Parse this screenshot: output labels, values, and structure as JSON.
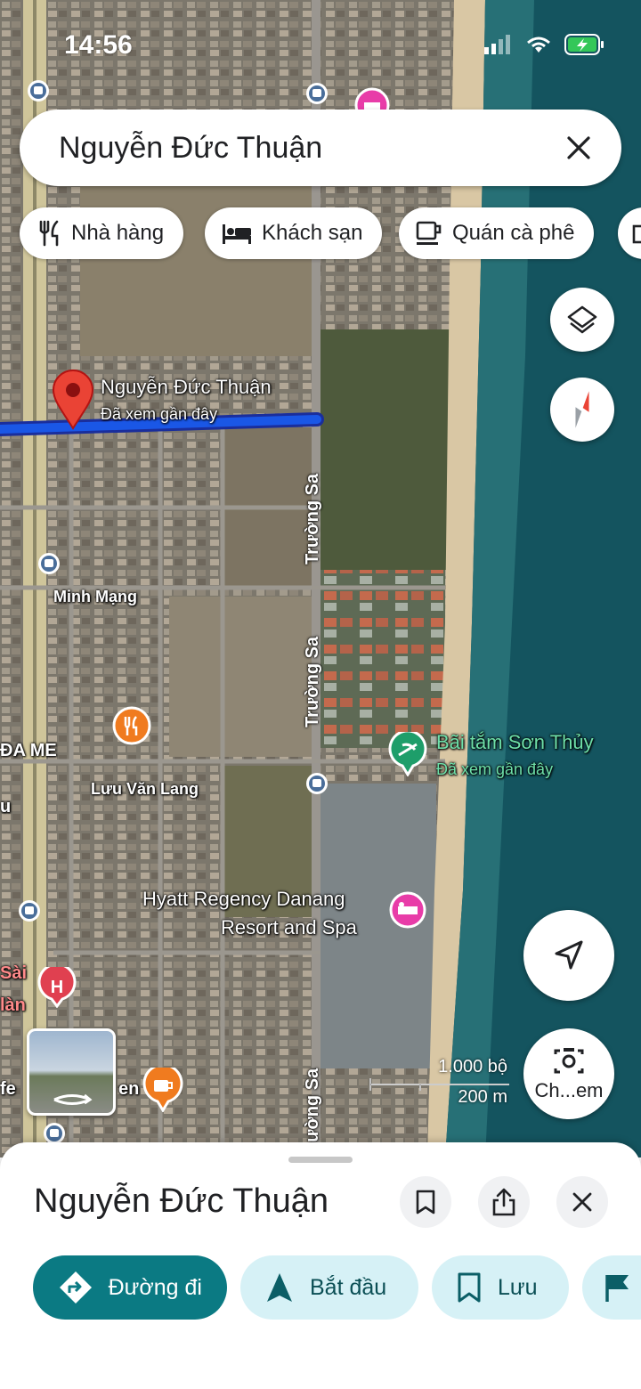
{
  "status_bar": {
    "time": "14:56"
  },
  "search": {
    "query": "Nguyễn Đức Thuận"
  },
  "chips": [
    {
      "label": "Nhà hàng",
      "icon": "fork-knife-icon"
    },
    {
      "label": "Khách sạn",
      "icon": "bed-icon"
    },
    {
      "label": "Quán cà phê",
      "icon": "coffee-cup-icon"
    }
  ],
  "map": {
    "pin": {
      "title": "Nguyễn Đức Thuận",
      "subtitle": "Đã xem gần đây"
    },
    "beach": {
      "title": "Bãi tắm Sơn Thủy",
      "subtitle": "Đã xem gần đây"
    },
    "hotel": {
      "line1": "Hyatt Regency Danang",
      "line2": "Resort and Spa"
    },
    "streets": {
      "minh_mang": "Minh Mạng",
      "luu_van_lang": "Lưu Văn Lang",
      "truong_sa": "Trường Sa",
      "da_me": "ĐA ME",
      "sai": "Sài",
      "han": "làn",
      "fe": "fe",
      "en": "en",
      "u": "u",
      "uong_sa": "ường Sa"
    },
    "scale": {
      "imperial": "1.000 bộ",
      "metric": "200 m"
    },
    "camera_label": "Ch...em"
  },
  "sheet": {
    "title": "Nguyễn Đức Thuận",
    "actions": [
      {
        "label": "Đường đi",
        "icon": "directions-icon"
      },
      {
        "label": "Bắt đầu",
        "icon": "navigate-arrow-icon"
      },
      {
        "label": "Lưu",
        "icon": "bookmark-icon"
      }
    ]
  },
  "colors": {
    "accent": "#0b7a83",
    "accent_light": "#d6f1f6",
    "route_blue": "#1a57e6",
    "pin_red": "#ea4335"
  }
}
